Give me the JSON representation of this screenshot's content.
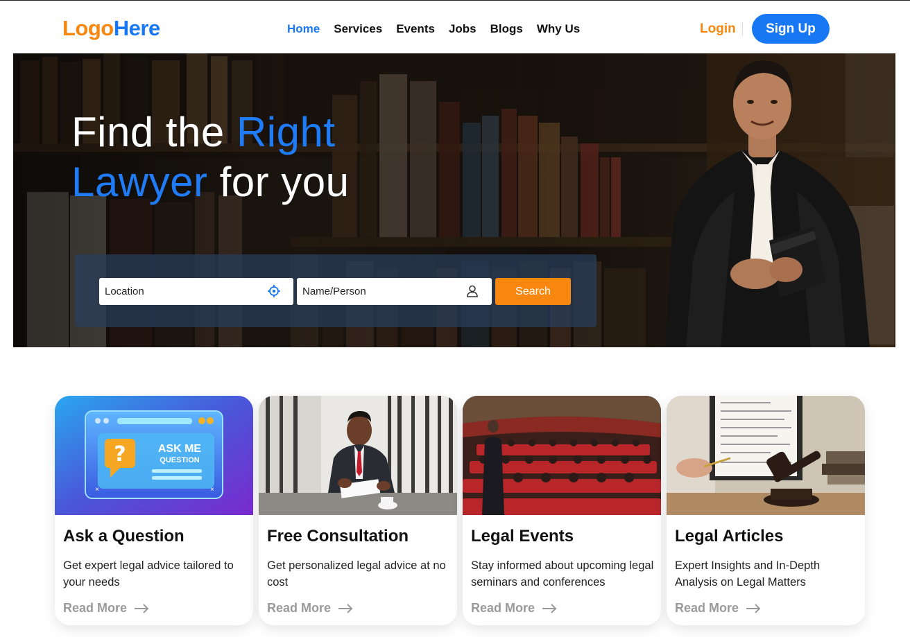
{
  "brand": {
    "logo_part1": "Logo",
    "logo_part2": "Here",
    "primary_color": "#1877f2",
    "accent_color": "#f7870f"
  },
  "nav": {
    "items": [
      {
        "label": "Home",
        "active": true
      },
      {
        "label": "Services",
        "active": false
      },
      {
        "label": "Events",
        "active": false
      },
      {
        "label": "Jobs",
        "active": false
      },
      {
        "label": "Blogs",
        "active": false
      },
      {
        "label": "Why Us",
        "active": false
      }
    ],
    "login_label": "Login",
    "signup_label": "Sign Up"
  },
  "hero": {
    "title_line1_a": "Find the ",
    "title_line1_b": "Right",
    "title_line2_a": "Lawyer",
    "title_line2_b": " for you",
    "location_placeholder": "Location",
    "location_icon": "location-target-icon",
    "name_placeholder": "Name/Person",
    "name_icon": "person-icon",
    "search_label": "Search"
  },
  "cards": [
    {
      "title": "Ask a Question",
      "text": "Get expert legal advice tailored to your needs",
      "link": "Read More",
      "image_text_1": "ASK ME",
      "image_text_2": "QUESTION"
    },
    {
      "title": "Free Consultation",
      "text": "Get personalized legal advice at no cost",
      "link": "Read More"
    },
    {
      "title": "Legal Events",
      "text": "Stay informed about upcoming legal seminars and conferences",
      "link": "Read More"
    },
    {
      "title": "Legal Articles",
      "text": "Expert Insights and In-Depth Analysis on Legal Matters",
      "link": "Read More"
    }
  ]
}
